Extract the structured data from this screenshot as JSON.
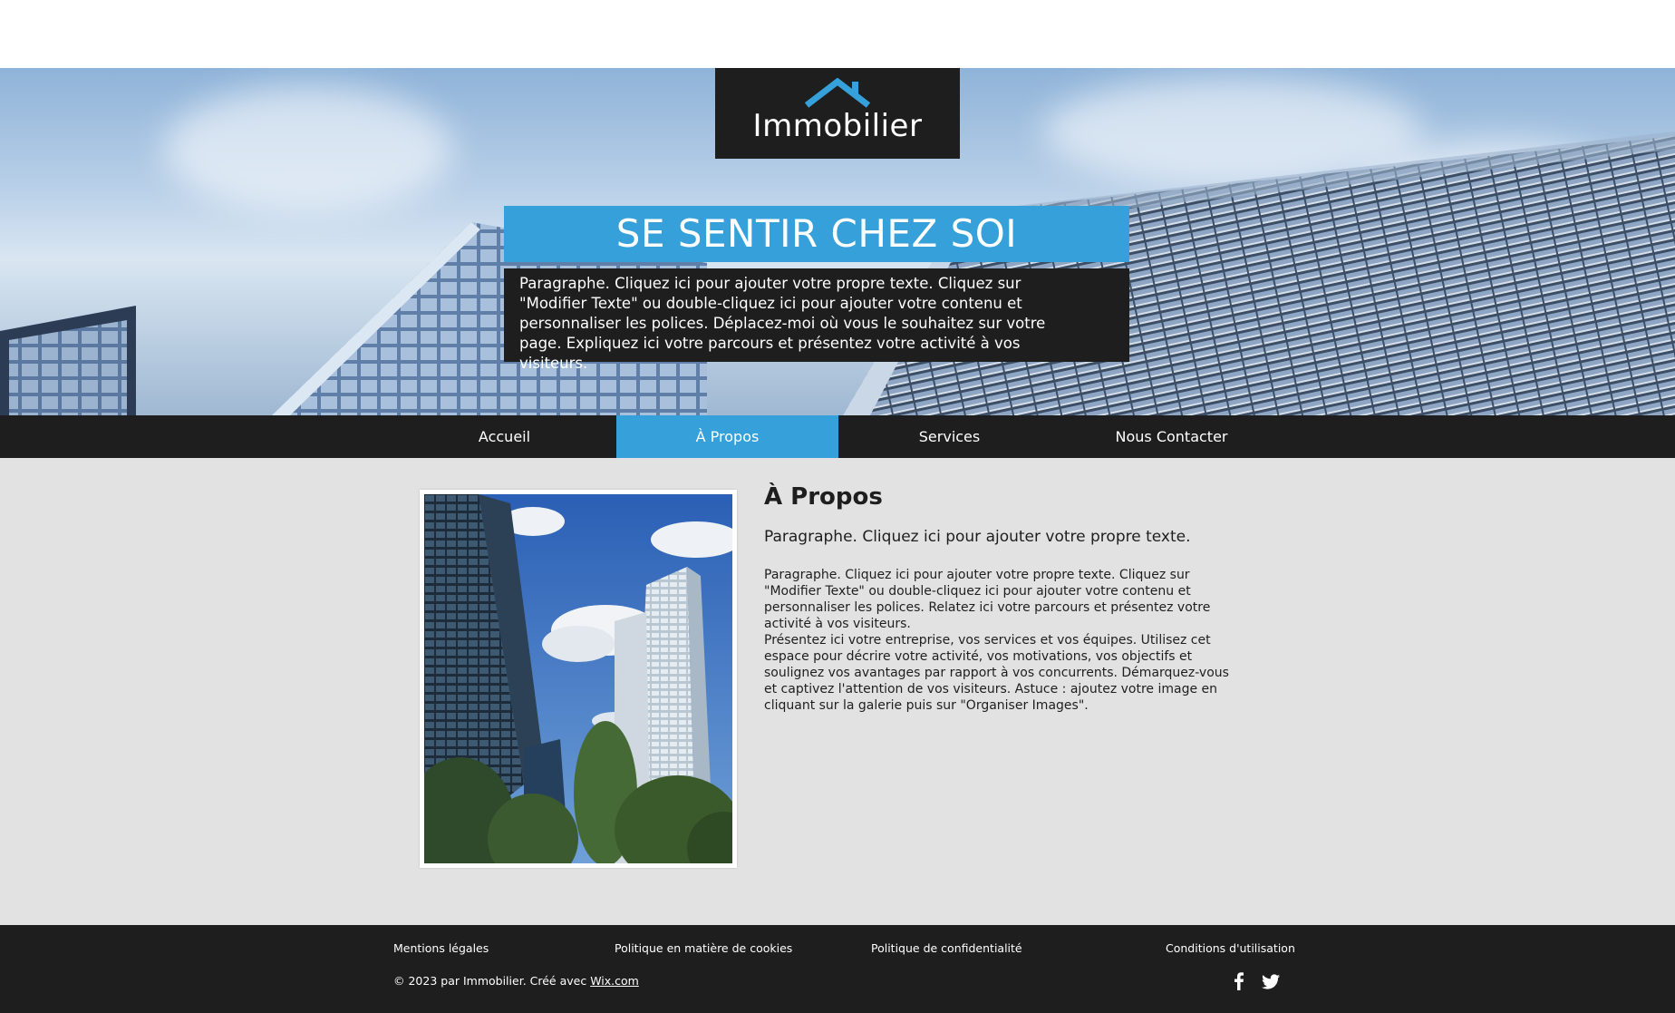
{
  "logo": {
    "text": "Immobilier"
  },
  "hero": {
    "headline": "SE SENTIR CHEZ SOI",
    "paragraph": "Paragraphe. Cliquez ici pour ajouter votre propre texte. Cliquez sur \"Modifier Texte\" ou double-cliquez ici pour ajouter votre contenu et personnaliser les polices. Déplacez-moi où vous le souhaitez sur votre page. Expliquez ici votre parcours et présentez votre activité à vos visiteurs."
  },
  "nav": {
    "items": [
      {
        "label": "Accueil"
      },
      {
        "label": "À Propos"
      },
      {
        "label": "Services"
      },
      {
        "label": "Nous Contacter"
      }
    ],
    "active": "À Propos"
  },
  "about": {
    "title": "À Propos",
    "subtitle": "Paragraphe. Cliquez ici pour ajouter votre propre texte.",
    "paragraph1": "Paragraphe. Cliquez ici pour ajouter votre propre texte. Cliquez sur \"Modifier Texte\" ou double-cliquez ici pour ajouter votre contenu et personnaliser les polices. Relatez ici votre parcours et présentez votre activité à vos visiteurs.",
    "paragraph2": "Présentez ici votre entreprise, vos services et vos équipes. Utilisez cet espace pour décrire votre activité, vos motivations, vos objectifs et soulignez vos avantages par rapport à vos concurrents. Démarquez-vous et captivez l'attention de vos visiteurs. Astuce : ajoutez votre image en cliquant sur la galerie puis sur \"Organiser Images\"."
  },
  "footer": {
    "links": [
      {
        "label": "Mentions légales"
      },
      {
        "label": "Politique en matière de cookies"
      },
      {
        "label": "Politique de confidentialité"
      },
      {
        "label": "Conditions d'utilisation"
      }
    ],
    "copyright": "© 2023 par Immobilier. Créé avec ",
    "wix_link": "Wix.com",
    "social": [
      "facebook-icon",
      "twitter-icon"
    ]
  },
  "colors": {
    "accent": "#35a0d9",
    "dark": "#1e1e1e",
    "content_bg": "#e2e2e2",
    "white": "#ffffff"
  }
}
